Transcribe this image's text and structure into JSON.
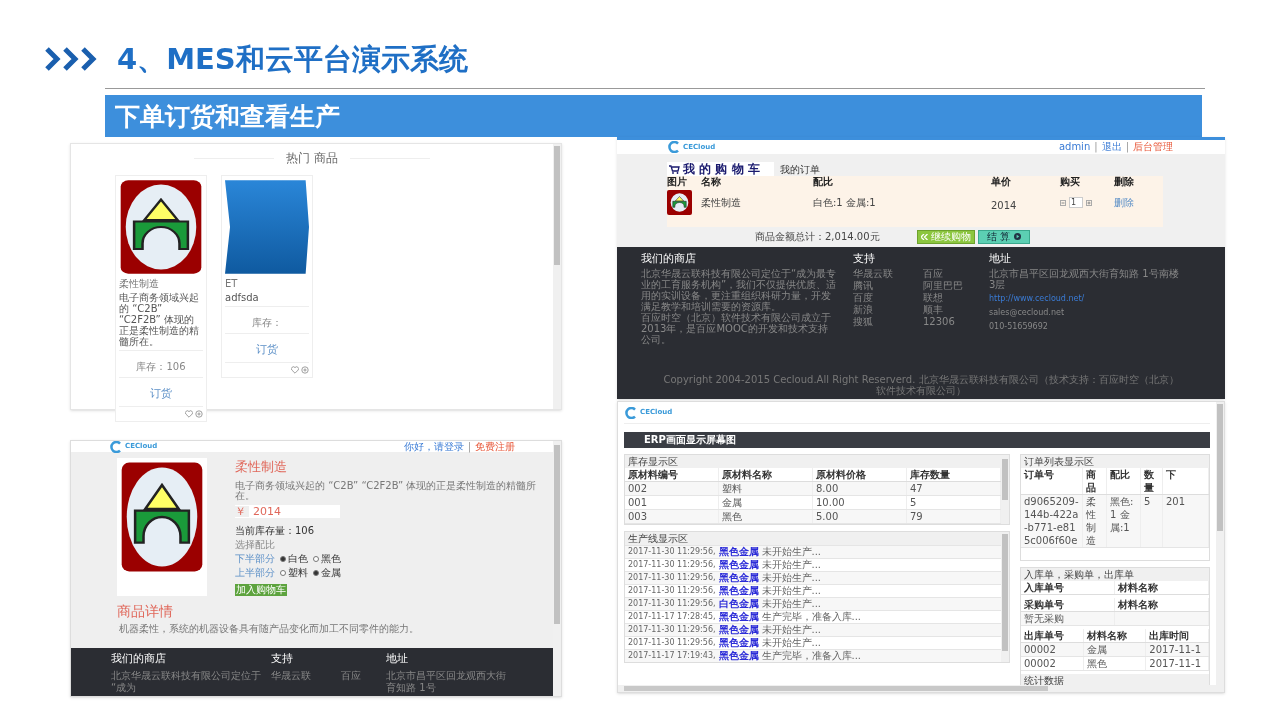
{
  "slide": {
    "title": "4、MES和云平台演示系统",
    "section": "下单订货和查看生产"
  },
  "hot_products": {
    "heading": "热门 商品",
    "products": [
      {
        "kind": "logo",
        "name": "柔性制造",
        "description": "电子商务领域兴起的 “C2B” “C2F2B” 体现的正是柔性制造的精髓所在。",
        "stock": "库存：106",
        "order": "订货"
      },
      {
        "kind": "ribbon",
        "name": "ET",
        "description": "adfsda",
        "stock": "库存：",
        "order": "订货"
      }
    ]
  },
  "product_detail": {
    "logo_text": "CECloud",
    "separator": "|",
    "links": [
      {
        "label": "你好，请登录",
        "kind": "plain"
      },
      {
        "label": "免费注册",
        "kind": "accent"
      }
    ],
    "title": "柔性制造",
    "description": "电子商务领域兴起的 “C2B” “C2F2B” 体现的正是柔性制造的精髓所在。",
    "currency": "￥",
    "price": "2014",
    "stock": "当前库存量：106",
    "options_label": "选择配比",
    "options": [
      {
        "part": "下半部分",
        "choices": [
          {
            "label": "白色",
            "selected": true
          },
          {
            "label": "黑色",
            "selected": false
          }
        ]
      },
      {
        "part": "上半部分",
        "choices": [
          {
            "label": "塑料",
            "selected": false
          },
          {
            "label": "金属",
            "selected": true
          }
        ]
      }
    ],
    "add_to_cart": "加入购物车",
    "details_heading": "商品详情",
    "details": "机器柔性，系统的机器设备具有随产品变化而加工不同零件的能力。",
    "footer": {
      "headings": [
        "我们的商店",
        "支持",
        "地址"
      ],
      "first_lines": [
        "北京华晟云联科技有限公司定位于 “成为",
        "华晟云联",
        "百应",
        "北京市昌平区回龙观西大街育知路 1号"
      ]
    }
  },
  "cart": {
    "logo_text": "CECloud",
    "separator": "|",
    "links": [
      {
        "label": "admin",
        "kind": "plain"
      },
      {
        "label": "退出",
        "kind": "plain"
      },
      {
        "label": "后台管理",
        "kind": "accent"
      }
    ],
    "tabs": [
      {
        "label": "我 的 购 物 车",
        "selected": true
      },
      {
        "label": "我的订单",
        "selected": false
      }
    ],
    "columns": [
      "图片",
      "名称",
      "配比",
      "单价",
      "购买",
      "删除"
    ],
    "rows": [
      {
        "name": "柔性制造",
        "ratio": "白色:1 金属:1",
        "price": "2014",
        "quantity": "1",
        "delete": "删除"
      }
    ],
    "total": "商品金额总计：2,014.00元",
    "continue": "继续购物",
    "checkout": "结 算",
    "footer": {
      "store_heading": "我们的商店",
      "store_text": [
        "北京华晟云联科技有限公司定位于“成为最专业的工育服务机构”，我们不仅提供优质、适用的实训设备，更注重组织科研力量，开发满足教学和培训需要的资源库。",
        "百应时空（北京）软件技术有限公司成立于2013年，是百应MOOC的开发和技术支持公司。"
      ],
      "support_heading": "支持",
      "support_links": [
        "华晟云联",
        "腾讯",
        "百度",
        "新浪",
        "搜狐",
        "百应",
        "阿里巴巴",
        "联想",
        "顺丰",
        "12306"
      ],
      "address_heading": "地址",
      "address": "北京市昌平区回龙观西大街育知路 1号南楼3层",
      "website": "http://www.cecloud.net/",
      "email": "sales@cecloud.net",
      "phone": "010-51659692",
      "copyright": "Copyright 2004-2015 Cecloud.All Right Reserverd. 北京华晟云联科技有限公司（技术支持：百应时空（北京）软件技术有限公司）"
    }
  },
  "erp": {
    "logo_text": "CECloud",
    "title": "ERP画面显示屏幕图",
    "inventory": {
      "title": "库存显示区",
      "columns": [
        "原材料编号",
        "原材料名称",
        "原材料价格",
        "库存数量"
      ],
      "rows": [
        [
          "002",
          "塑料",
          "8.00",
          "47"
        ],
        [
          "001",
          "金属",
          "10.00",
          "5"
        ],
        [
          "003",
          "黑色",
          "5.00",
          "79"
        ]
      ]
    },
    "production": {
      "title": "生产线显示区",
      "rows": [
        {
          "time": "2017-11-30 11:29:56,",
          "product": "黑色金属",
          "status": "未开始生产..."
        },
        {
          "time": "2017-11-30 11:29:56,",
          "product": "黑色金属",
          "status": "未开始生产..."
        },
        {
          "time": "2017-11-30 11:29:56,",
          "product": "黑色金属",
          "status": "未开始生产..."
        },
        {
          "time": "2017-11-30 11:29:56,",
          "product": "黑色金属",
          "status": "未开始生产..."
        },
        {
          "time": "2017-11-30 11:29:56,",
          "product": "白色金属",
          "status": "未开始生产..."
        },
        {
          "time": "2017-11-17 17:28:45,",
          "product": "黑色金属",
          "status": "生产完毕，准备入库..."
        },
        {
          "time": "2017-11-30 11:29:56,",
          "product": "黑色金属",
          "status": "未开始生产..."
        },
        {
          "time": "2017-11-30 11:29:56,",
          "product": "黑色金属",
          "status": "未开始生产..."
        },
        {
          "time": "2017-11-17 17:19:43,",
          "product": "黑色金属",
          "status": "生产完毕，准备入库..."
        }
      ]
    },
    "orders": {
      "title": "订单列表显示区",
      "columns": [
        "订单号",
        "商品",
        "配比",
        "数量",
        "下"
      ],
      "rows": [
        [
          "d9065209-144b-422a-b771-e815c006f60e",
          "柔性制造",
          "黑色:1 金属:1",
          "5",
          "201"
        ]
      ]
    },
    "documents": {
      "title": "入库单，采购单，出库单",
      "tables": [
        {
          "columns": [
            "入库单号",
            "材料名称"
          ]
        },
        {
          "columns": [
            "采购单号",
            "材料名称"
          ],
          "rows": [
            [
              "暂无采购"
            ]
          ]
        },
        {
          "columns": [
            "出库单号",
            "材料名称",
            "出库时间"
          ],
          "rows": [
            [
              "00002",
              "金属",
              "2017-11-1"
            ],
            [
              "00002",
              "黑色",
              "2017-11-1"
            ]
          ]
        }
      ]
    },
    "stats_title": "统计数据"
  }
}
